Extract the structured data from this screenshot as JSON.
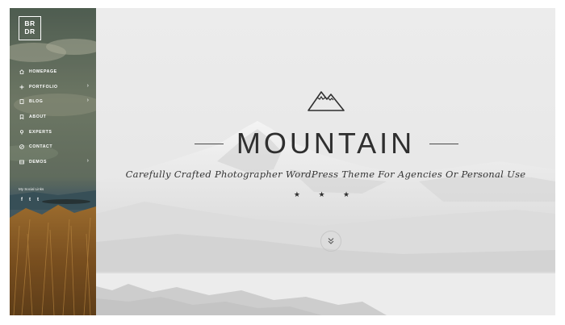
{
  "brand": {
    "logo_line1": "BR",
    "logo_line2": "DR"
  },
  "nav": {
    "items": [
      {
        "label": "HOMEPAGE",
        "icon": "home-icon",
        "has_submenu": false
      },
      {
        "label": "PORTFOLIO",
        "icon": "plus-icon",
        "has_submenu": true
      },
      {
        "label": "BLOG",
        "icon": "page-icon",
        "has_submenu": true
      },
      {
        "label": "ABOUT",
        "icon": "bookmark-icon",
        "has_submenu": false
      },
      {
        "label": "EXPERTS",
        "icon": "pin-icon",
        "has_submenu": false
      },
      {
        "label": "CONTACT",
        "icon": "compass-icon",
        "has_submenu": false
      },
      {
        "label": "DEMOS",
        "icon": "stack-icon",
        "has_submenu": true
      }
    ],
    "submenu_arrow": "›"
  },
  "social": {
    "title": "My Social Links",
    "links": [
      {
        "glyph": "f",
        "icon": "facebook-icon"
      },
      {
        "glyph": "t",
        "icon": "twitter-icon"
      },
      {
        "glyph": "t",
        "icon": "tumblr-icon"
      }
    ]
  },
  "hero": {
    "title": "MOUNTAIN",
    "tagline": "Carefully Crafted Photographer WordPress Theme For Agencies Or Personal Use",
    "stars": "★ ★ ★",
    "scroll_icon": "double-chevron-down-icon"
  },
  "colors": {
    "sidebar_text": "#ffffff",
    "title": "#2f2f2f",
    "hero_bg": "#e9e9e9"
  }
}
